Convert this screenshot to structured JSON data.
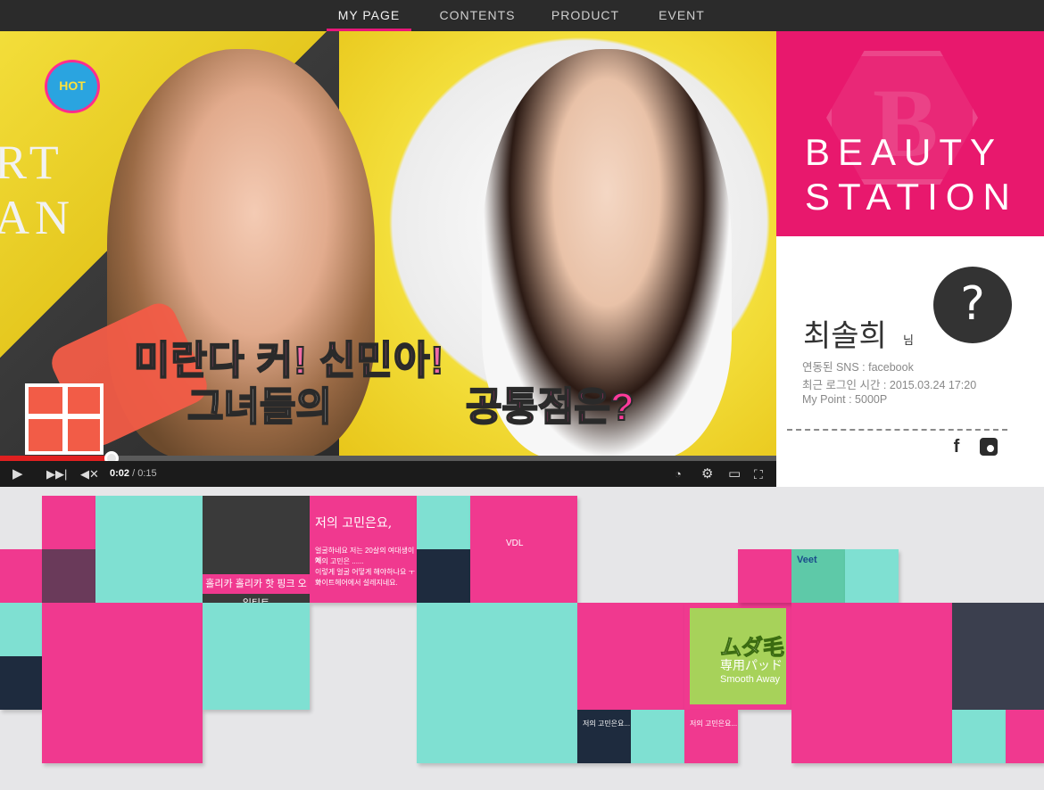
{
  "nav": {
    "items": [
      {
        "label": "MY PAGE",
        "active": true
      },
      {
        "label": "CONTENTS",
        "active": false
      },
      {
        "label": "PRODUCT",
        "active": false
      },
      {
        "label": "EVENT",
        "active": false
      }
    ]
  },
  "video": {
    "badge": "HOT",
    "wall_left": "RT",
    "wall_left2": "AN",
    "wall_mid": "T",
    "caption_line1": "미란다 커! 신민아!",
    "caption_line2": "그녀들의",
    "caption_line3": "공통점은?",
    "current_time": "0:02",
    "duration": "/ 0:15",
    "progress": 0.144,
    "icons": {
      "play": "play-icon",
      "next": "next-icon",
      "mute": "mute-icon",
      "watch_later": "clock-icon",
      "settings": "gear-icon",
      "theater": "theater-icon",
      "fullscreen": "fullscreen-icon"
    }
  },
  "station": {
    "title_line1": "BEAUTY",
    "title_line2": "STATION",
    "logo_letter": "B",
    "accent": "#e8186d"
  },
  "profile": {
    "avatar_glyph": "?",
    "name": "최솔희",
    "name_suffix": "님",
    "sns": "연동된 SNS : facebook",
    "last_login": "최근 로그인 시간 : 2015.03.24 17:20",
    "points": "My Point : 5000P",
    "facebook_glyph": "f"
  },
  "mosaic": {
    "label_vdl": "VDL",
    "label_holika": "홀리카 홀리카 핫 핑크 오일틴트",
    "note_title": "저의 고민은요,",
    "note_lines": [
      "얼굴하네요 저는 20살의 여대생이에",
      "저의 고민은 ......",
      "이렇게 얼굴 어떻게 해야하나요 ㅜㅜ",
      "화이트헤어에서 설레지네요."
    ],
    "note_short": "저의 고민은요...",
    "veet": "Veet",
    "jp_title": "ムダ毛",
    "jp_sub": "専用パッド",
    "jp_sub2": "Smooth Away"
  },
  "colors": {
    "pink": "#f0398f",
    "teal": "#7fe0d2",
    "navy": "#1e2b3e",
    "nav_bg": "#2b2b2b"
  }
}
